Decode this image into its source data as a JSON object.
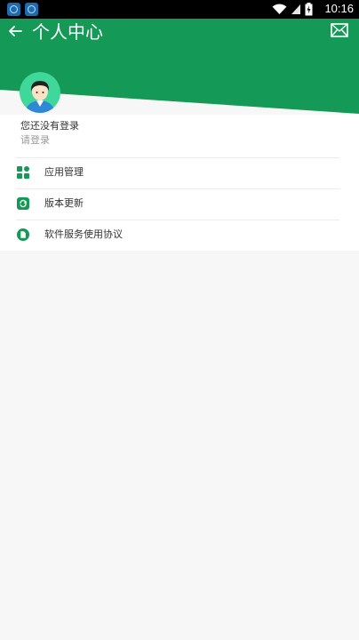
{
  "status_bar": {
    "time": "10:16",
    "icons": [
      "app-notification-icon",
      "app-notification-icon",
      "wifi-icon",
      "signal-icon",
      "battery-icon"
    ]
  },
  "header": {
    "title": "个人中心",
    "back_icon": "arrow-left-icon",
    "message_icon": "mail-icon",
    "color": "#159957"
  },
  "profile": {
    "avatar_icon": "default-user-avatar",
    "status_text": "您还没有登录",
    "login_text": "请登录"
  },
  "menu": [
    {
      "icon": "apps-grid-icon",
      "label": "应用管理"
    },
    {
      "icon": "refresh-icon",
      "label": "版本更新"
    },
    {
      "icon": "document-icon",
      "label": "软件服务使用协议"
    }
  ],
  "colors": {
    "accent": "#159957",
    "page_background": "#f7f7f7",
    "text_primary": "#333333",
    "text_secondary": "#9a9a9a"
  }
}
